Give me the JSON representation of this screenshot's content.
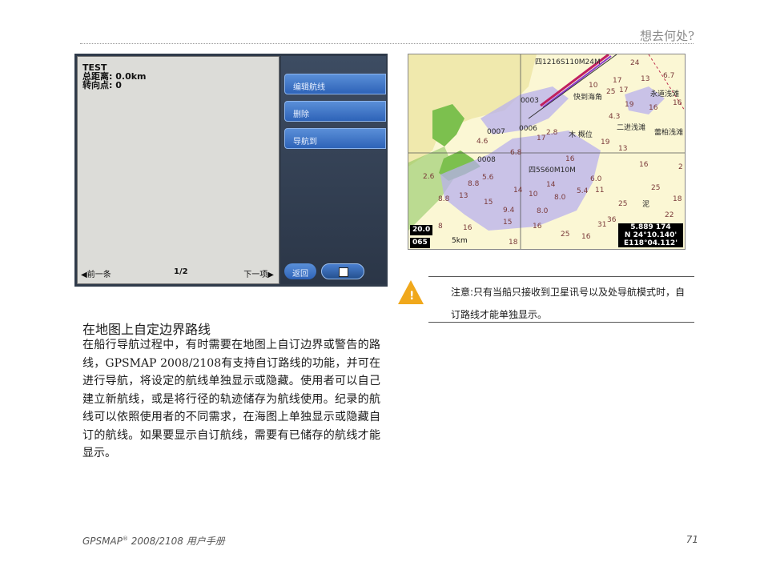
{
  "header": {
    "title": "想去何处?"
  },
  "device_screen": {
    "route_name": "TEST",
    "distance_label": "总距离:",
    "distance_value": "0.0km",
    "turns_label": "转向点:",
    "turns_value": "0",
    "prev_label": "前一条",
    "page_indicator": "1/2",
    "next_label": "下一项",
    "menu": [
      "编辑航线",
      "删除",
      "导航到"
    ],
    "back_label": "返回"
  },
  "map": {
    "labels": [
      "四1216S110M24M",
      "0003",
      "0007",
      "0006",
      "0008",
      "四5S60M10M",
      "永道浅滩",
      "二进浅滩",
      "蕾柏浅滩",
      "快到海角",
      "木 概位",
      "泥"
    ],
    "depths": [
      "24",
      "6.7",
      "10",
      "17",
      "13",
      "25",
      "17",
      "16",
      "19",
      "16",
      "4.3",
      "4.6",
      "17",
      "2.8",
      "19",
      "6.8",
      "16",
      "13",
      "16",
      "2",
      "2.6",
      "5.6",
      "6.0",
      "8.8",
      "14",
      "10",
      "14",
      "11",
      "25",
      "8.8",
      "13",
      "15",
      "8.0",
      "5.4",
      "25",
      "18",
      "9.4",
      "8.0",
      "22",
      "8",
      "16",
      "15",
      "16",
      "31",
      "36",
      "18",
      "25",
      "16"
    ],
    "scale_value": "20.0",
    "heading_value": "065",
    "scale_bar_label": "5km",
    "speed": "5.889",
    "depth_readout": "174",
    "latitude": "N 24°10.140'",
    "longitude": "E118°04.112'"
  },
  "note": {
    "text": "注意:只有当船只接收到卫星讯号以及处导航模式时，自订路线才能单独显示。"
  },
  "section": {
    "heading": "在地图上自定边界路线",
    "body": "在船行导航过程中，有时需要在地图上自订边界或警告的路线，GPSMAP 2008/2108有支持自订路线的功能，并可在进行导航，将设定的航线单独显示或隐藏。使用者可以自己建立新航线，或是将行径的轨迹储存为航线使用。纪录的航线可以依照使用者的不同需求，在海图上单独显示或隐藏自订的航线。如果要显示自订航线，需要有已储存的航线才能显示。"
  },
  "footer": {
    "product": "GPSMAP",
    "reg_mark": "®",
    "manual": " 2008/2108 用户手册",
    "page_number": "71"
  },
  "colors": {
    "warning": "#f0a81c",
    "land": "#7cc04e",
    "water_shallow": "#b8b0ee",
    "route": "#c02060"
  }
}
